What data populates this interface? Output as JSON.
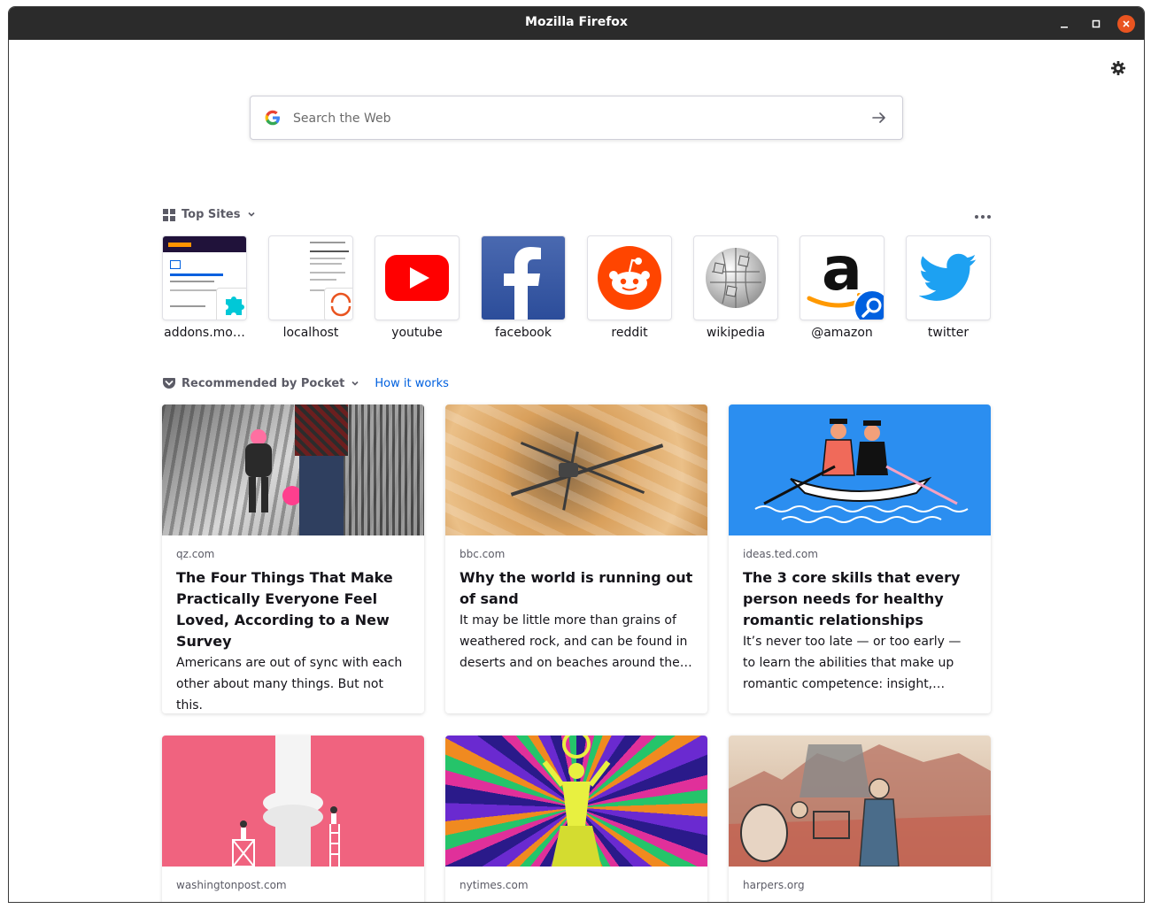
{
  "window": {
    "title": "Mozilla Firefox"
  },
  "search": {
    "placeholder": "Search the Web"
  },
  "top_sites": {
    "heading": "Top Sites",
    "items": [
      {
        "label": "addons.mo…"
      },
      {
        "label": "localhost"
      },
      {
        "label": "youtube"
      },
      {
        "label": "facebook"
      },
      {
        "label": "reddit"
      },
      {
        "label": "wikipedia"
      },
      {
        "label": "@amazon"
      },
      {
        "label": "twitter"
      }
    ]
  },
  "pocket": {
    "heading": "Recommended by Pocket",
    "how_it_works": "How it works",
    "cards": [
      {
        "source": "qz.com",
        "title": "The Four Things That Make Practically Everyone Feel Loved, According to a New Survey",
        "excerpt": "Americans are out of sync with each other about many things. But not this."
      },
      {
        "source": "bbc.com",
        "title": "Why the world is running out of sand",
        "excerpt": "It may be little more than grains of weathered rock, and can be found in deserts and on beaches around the…"
      },
      {
        "source": "ideas.ted.com",
        "title": "The 3 core skills that every person needs for healthy romantic relationships",
        "excerpt": "It’s never too late — or too early — to learn the abilities that make up romantic competence: insight,…"
      },
      {
        "source": "washingtonpost.com",
        "title": "",
        "excerpt": ""
      },
      {
        "source": "nytimes.com",
        "title": "",
        "excerpt": ""
      },
      {
        "source": "harpers.org",
        "title": "",
        "excerpt": ""
      }
    ]
  },
  "colors": {
    "titlebar": "#2b2b2b",
    "close": "#e95420",
    "link": "#0060df",
    "youtube": "#ff0000",
    "facebook": "#3b5998",
    "reddit": "#ff4500",
    "twitter": "#1da1f2",
    "ted_bg": "#2b8ef0"
  },
  "icons": [
    "gear-icon",
    "google-icon",
    "arrow-right-icon",
    "grid-icon",
    "pocket-icon",
    "chevron-down-icon",
    "more-icon",
    "search-badge-icon"
  ]
}
